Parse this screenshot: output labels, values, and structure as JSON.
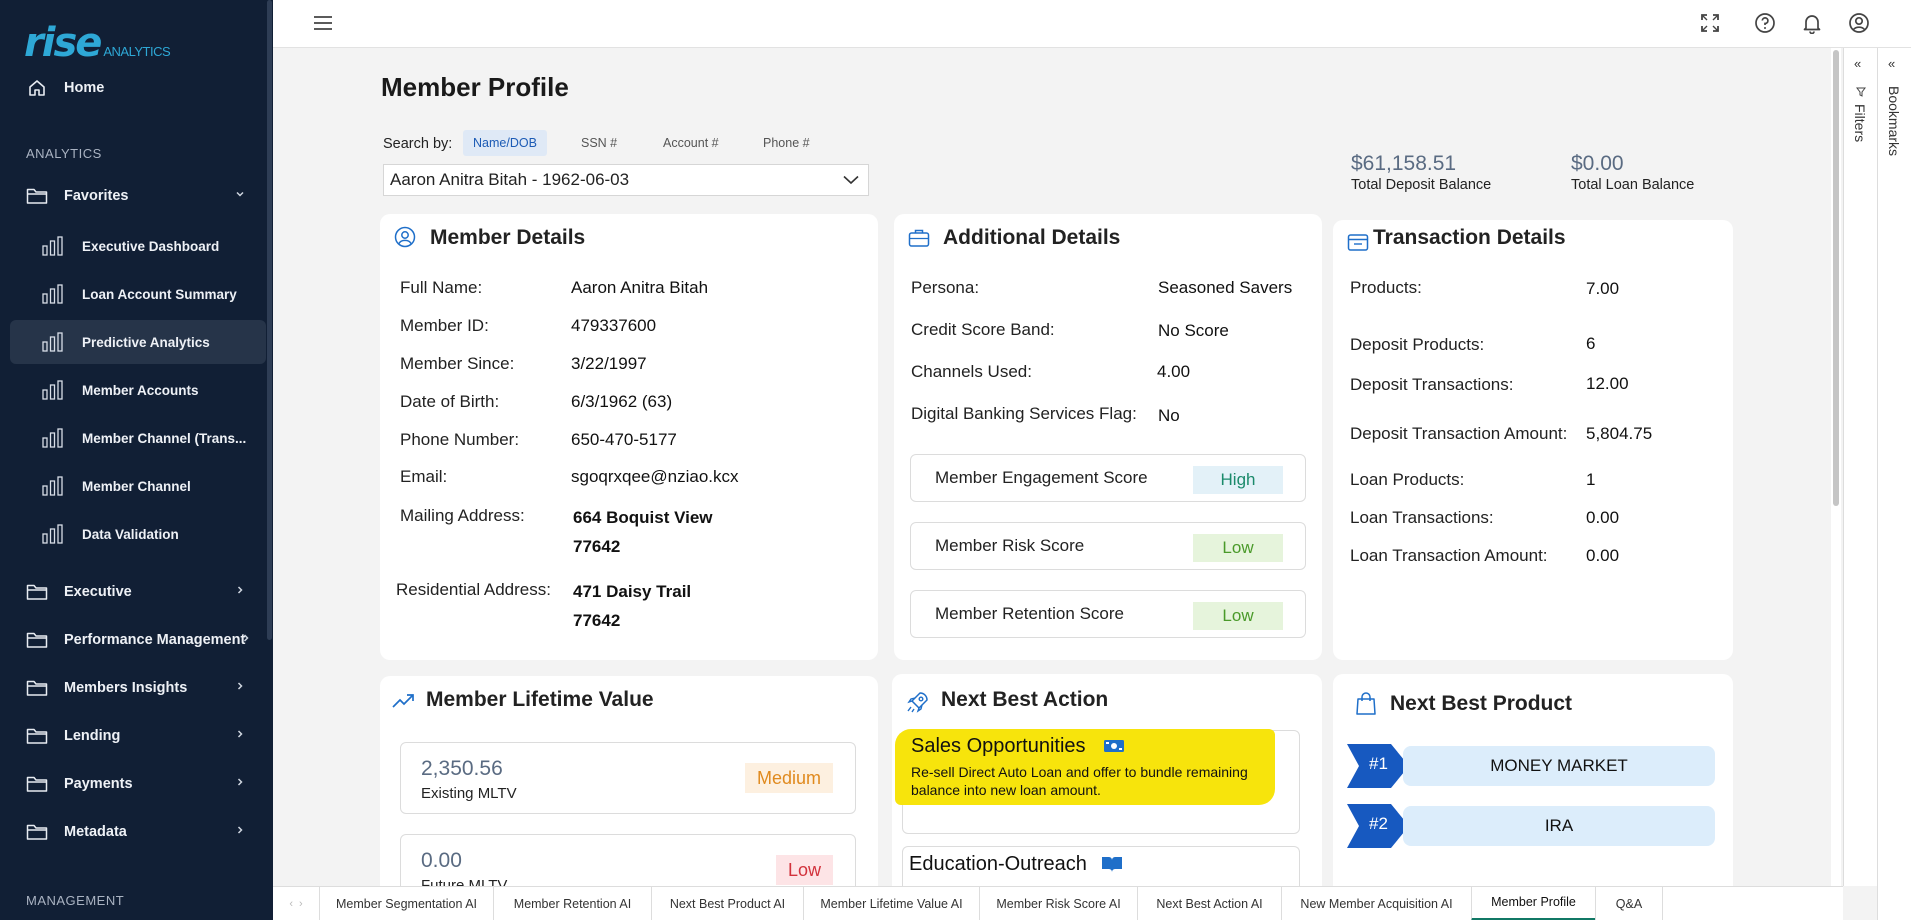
{
  "brand": {
    "name_main": "rise",
    "name_sub": "ANALYTICS"
  },
  "sidebar": {
    "home": "Home",
    "section_analytics": "ANALYTICS",
    "favorites": "Favorites",
    "favorites_items": [
      "Executive Dashboard",
      "Loan Account Summary",
      "Predictive Analytics",
      "Member Accounts",
      "Member Channel (Trans...",
      "Member Channel",
      "Data Validation"
    ],
    "active_item": "Predictive Analytics",
    "folders": [
      "Executive",
      "Performance Management",
      "Members Insights",
      "Lending",
      "Payments",
      "Metadata"
    ],
    "section_management": "MANAGEMENT"
  },
  "side_panels": {
    "filters": "Filters",
    "bookmarks": "Bookmarks"
  },
  "page": {
    "title": "Member Profile",
    "search_label": "Search by:",
    "search_tabs": [
      "Name/DOB",
      "SSN #",
      "Account #",
      "Phone #"
    ],
    "search_active": "Name/DOB",
    "selected_member": "Aaron Anitra Bitah - 1962-06-03",
    "kpis": [
      {
        "value": "$61,158.51",
        "label": "Total Deposit Balance"
      },
      {
        "value": "$0.00",
        "label": "Total Loan Balance"
      }
    ]
  },
  "member_details": {
    "title": "Member Details",
    "rows": [
      {
        "label": "Full Name:",
        "value": "Aaron Anitra Bitah"
      },
      {
        "label": "Member ID:",
        "value": "479337600"
      },
      {
        "label": "Member Since:",
        "value": "3/22/1997"
      },
      {
        "label": "Date of Birth:",
        "value": "6/3/1962 (63)"
      },
      {
        "label": "Phone Number:",
        "value": "650-470-5177"
      },
      {
        "label": "Email:",
        "value": "sgoqrxqee@nziao.kcx"
      }
    ],
    "mailing_label": "Mailing Address:",
    "mailing_line1": "664 Boquist View",
    "mailing_line2": "77642",
    "residential_label": "Residential Address:",
    "residential_line1": "471 Daisy Trail",
    "residential_line2": "77642"
  },
  "additional_details": {
    "title": "Additional Details",
    "rows": [
      {
        "label": "Persona:",
        "value": "Seasoned Savers"
      },
      {
        "label": "Credit Score Band:",
        "value": "No Score"
      },
      {
        "label": "Channels Used:",
        "value": "4.00"
      },
      {
        "label": "Digital Banking Services Flag:",
        "value": "No"
      }
    ],
    "scores": [
      {
        "label": "Member Engagement Score",
        "value": "High",
        "color": "#1b8a6b",
        "bg": "#e3f1f8"
      },
      {
        "label": "Member Risk Score",
        "value": "Low",
        "color": "#4a9a2a",
        "bg": "#e6f4dc"
      },
      {
        "label": "Member Retention Score",
        "value": "Low",
        "color": "#4a9a2a",
        "bg": "#e6f4dc"
      }
    ]
  },
  "transaction_details": {
    "title": "Transaction Details",
    "rows": [
      {
        "label": "Products:",
        "value": "7.00"
      },
      {
        "label": "Deposit Products:",
        "value": "6"
      },
      {
        "label": "Deposit Transactions:",
        "value": "12.00"
      },
      {
        "label": "Deposit Transaction Amount:",
        "value": "5,804.75"
      },
      {
        "label": "Loan Products:",
        "value": "1"
      },
      {
        "label": "Loan Transactions:",
        "value": "0.00"
      },
      {
        "label": "Loan Transaction Amount:",
        "value": "0.00"
      }
    ]
  },
  "mltv": {
    "title": "Member Lifetime Value",
    "items": [
      {
        "value": "2,350.56",
        "label": "Existing MLTV",
        "badge": "Medium",
        "color": "#e08a1e",
        "bg": "#fdf0e0"
      },
      {
        "value": "0.00",
        "label": "Future MLTV",
        "badge": "Low",
        "color": "#d2323c",
        "bg": "#fde4e6"
      }
    ]
  },
  "nba": {
    "title": "Next Best Action",
    "sales_title": "Sales Opportunities",
    "sales_text": "Re-sell Direct Auto Loan and offer to bundle remaining balance into new loan amount.",
    "education_title": "Education-Outreach"
  },
  "nbp": {
    "title": "Next Best Product",
    "items": [
      {
        "rank": "#1",
        "name": "MONEY MARKET"
      },
      {
        "rank": "#2",
        "name": "IRA"
      }
    ]
  },
  "bottom_tabs": [
    "Member Segmentation AI",
    "Member Retention AI",
    "Next Best Product AI",
    "Member Lifetime Value AI",
    "Member Risk Score AI",
    "Next Best Action AI",
    "New Member Acquisition AI",
    "Member Profile",
    "Q&A"
  ],
  "active_bottom_tab": "Member Profile",
  "colors": {
    "sidebar_bg": "#111f35",
    "accent_blue": "#1f6fc9",
    "highlight": "#f7e40c"
  }
}
